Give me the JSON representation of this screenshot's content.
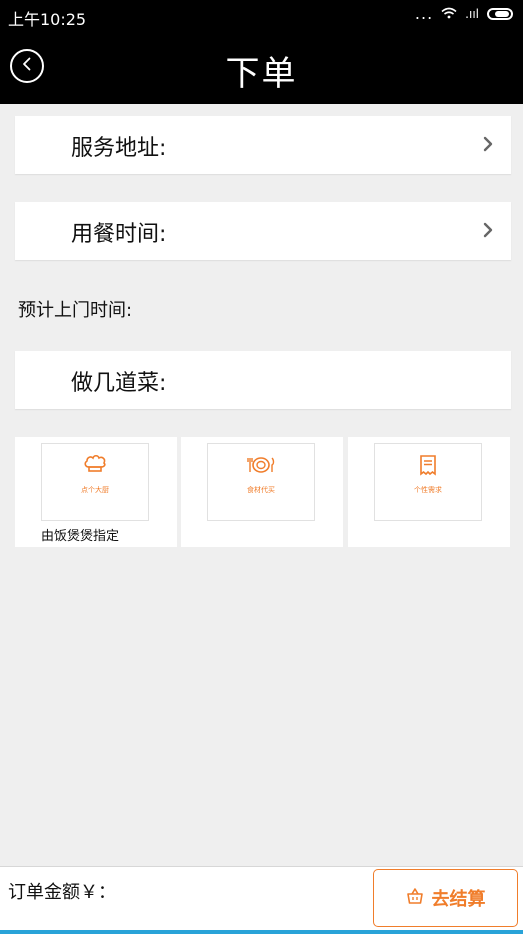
{
  "status_bar": {
    "time": "上午10:25",
    "dots": "...",
    "wifi_icon": "wifi-icon",
    "signal_text": ".ııl",
    "battery_icon": "battery-icon"
  },
  "header": {
    "title": "下单",
    "back_icon": "chevron-left-circle-icon"
  },
  "rows": {
    "service_address": "服务地址:",
    "meal_time": "用餐时间:",
    "dishes": "做几道菜:"
  },
  "estimated_arrival": "预计上门时间:",
  "options": [
    {
      "icon": "chef-hat-icon",
      "caption": "点个大厨",
      "note": "由饭煲煲指定"
    },
    {
      "icon": "meal-plate-icon",
      "caption": "食材代买",
      "note": ""
    },
    {
      "icon": "receipt-note-icon",
      "caption": "个性需求",
      "note": ""
    }
  ],
  "footer": {
    "amount_label": "订单金额￥：",
    "checkout_label": "去结算",
    "checkout_icon": "basket-icon"
  },
  "colors": {
    "accent": "#f07d2b",
    "header_bg": "#000000",
    "page_bg": "#efefef"
  }
}
